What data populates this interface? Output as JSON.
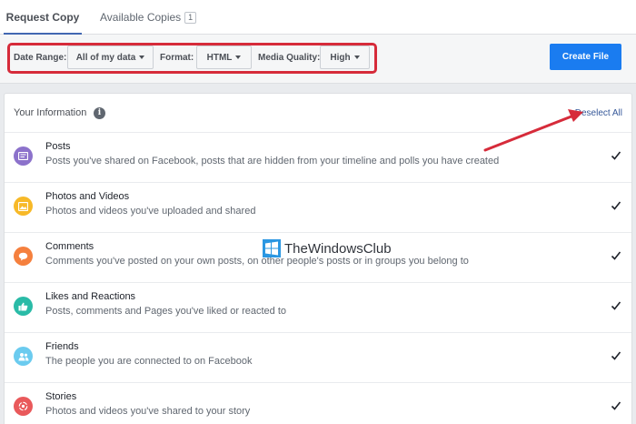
{
  "tabs": [
    {
      "label": "Request Copy"
    },
    {
      "label": "Available Copies",
      "count": "1"
    }
  ],
  "controls": {
    "date_range_label": "Date Range:",
    "date_range_value": "All of my data",
    "format_label": "Format:",
    "format_value": "HTML",
    "media_quality_label": "Media Quality:",
    "media_quality_value": "High",
    "create_button": "Create File"
  },
  "section": {
    "title": "Your Information",
    "deselect_all": "Deselect All"
  },
  "items": [
    {
      "title": "Posts",
      "description": "Posts you've shared on Facebook, posts that are hidden from your timeline and polls you have created",
      "icon": "posts-icon",
      "color": "#8c72cb"
    },
    {
      "title": "Photos and Videos",
      "description": "Photos and videos you've uploaded and shared",
      "icon": "photos-icon",
      "color": "#f7b928"
    },
    {
      "title": "Comments",
      "description": "Comments you've posted on your own posts, on other people's posts or in groups you belong to",
      "icon": "comment-icon",
      "color": "#f5803e"
    },
    {
      "title": "Likes and Reactions",
      "description": "Posts, comments and Pages you've liked or reacted to",
      "icon": "like-icon",
      "color": "#2abba7"
    },
    {
      "title": "Friends",
      "description": "The people you are connected to on Facebook",
      "icon": "friends-icon",
      "color": "#6bcbef"
    },
    {
      "title": "Stories",
      "description": "Photos and videos you've shared to your story",
      "icon": "stories-icon",
      "color": "#e9595b"
    }
  ],
  "watermark": {
    "text": "TheWindowsClub"
  },
  "colors": {
    "accent": "#1a7cf0",
    "highlight": "#d62b3a"
  }
}
